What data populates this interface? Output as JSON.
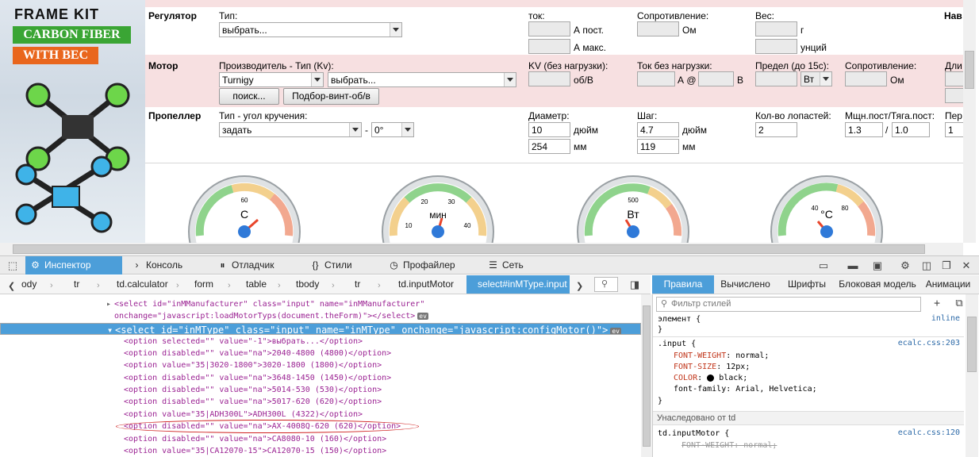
{
  "ad": {
    "line1": "FRAME KIT",
    "line2": "CARBON FIBER",
    "line3": "WITH BEC"
  },
  "form": {
    "regulator": {
      "title": "Регулятор",
      "type_label": "Тип:",
      "type_value": "выбрать...",
      "current_label": "ток:",
      "unit_a_const": "А пост.",
      "unit_a_max": "А макс.",
      "resistance_label": "Сопротивление:",
      "unit_ohm": "Ом",
      "weight_label": "Вес:",
      "unit_g": "г",
      "unit_oz": "унций",
      "nav_label": "Нав"
    },
    "motor": {
      "title": "Мотор",
      "manufacturer_label": "Производитель - Тип (Kv):",
      "manufacturer_value": "Turnigy",
      "type_value": "выбрать...",
      "kv_label": "KV (без нагрузки):",
      "unit_rpm_v": "об/В",
      "noload_label": "Ток без нагрузки:",
      "unit_a_at": "А @",
      "unit_v": "В",
      "limit_label": "Предел (до 15с):",
      "limit_unit_value": "Вт",
      "resistance_label": "Сопротивление:",
      "unit_ohm": "Ом",
      "extra_label": "Дли",
      "search_button": "поиск...",
      "match_button": "Подбор-винт-об/в"
    },
    "propeller": {
      "title": "Пропеллер",
      "type_label": "Тип - угол кручения:",
      "type_value": "задать",
      "dash": "-",
      "angle_value": "0°",
      "diameter_label": "Диаметр:",
      "diameter_in": "10",
      "unit_inch": "дюйм",
      "diameter_mm": "254",
      "unit_mm": "мм",
      "pitch_label": "Шаг:",
      "pitch_in": "4.7",
      "pitch_mm": "119",
      "blades_label": "Кол-во лопастей:",
      "blades_value": "2",
      "power_label": "Мщн.пост/Тяга.пост:",
      "power_value": "1.3",
      "slash": "/",
      "thrust_value": "1.0",
      "extra_label": "Пер",
      "extra_value": "1"
    },
    "gauges": [
      {
        "unit": "С",
        "ticks": [
          "60"
        ]
      },
      {
        "unit": "мин",
        "ticks": [
          "20",
          "30",
          "10",
          "40"
        ]
      },
      {
        "unit": "Вт",
        "ticks": [
          "500"
        ]
      },
      {
        "unit": "°С",
        "ticks": [
          "40",
          "80"
        ]
      }
    ]
  },
  "devtools": {
    "tabs": [
      {
        "label": "Инспектор",
        "icon": "inspector-icon"
      },
      {
        "label": "Консоль",
        "icon": "console-icon"
      },
      {
        "label": "Отладчик",
        "icon": "debugger-icon"
      },
      {
        "label": "Стили",
        "icon": "style-editor-icon"
      },
      {
        "label": "Профайлер",
        "icon": "profiler-icon"
      },
      {
        "label": "Сеть",
        "icon": "network-icon"
      }
    ],
    "breadcrumbs": [
      "ody",
      "tr",
      "td.calculator",
      "form",
      "table",
      "tbody",
      "tr",
      "td.inputMotor",
      "select#inMType.input"
    ],
    "side_tabs": [
      "Правила",
      "Вычислено",
      "Шрифты",
      "Блоковая модель",
      "Анимации"
    ],
    "code_lines": [
      {
        "text": "<select id=\"inMManufacturer\" class=\"input\" name=\"inMManufacturer\"",
        "indent": 1
      },
      {
        "text": "onchange=\"javascript:loadMotorTyps(document.theForm)\"></select>",
        "indent": 1
      },
      {
        "text": "<select id=\"inMType\" class=\"input\" name=\"inMType\" onchange=\"javascript:configMotor()\">",
        "indent": 1
      },
      {
        "text": "<option selected=\"\" value=\"-1\">выбрать...</option>",
        "indent": 2
      },
      {
        "text": "<option disabled=\"\" value=\"na\">2040-4800 (4800)</option>",
        "indent": 2
      },
      {
        "text": "<option value=\"35|3020-1800\">3020-1800 (1800)</option>",
        "indent": 2
      },
      {
        "text": "<option disabled=\"\" value=\"na\">3648-1450 (1450)</option>",
        "indent": 2
      },
      {
        "text": "<option disabled=\"\" value=\"na\">5014-530 (530)</option>",
        "indent": 2
      },
      {
        "text": "<option disabled=\"\" value=\"na\">5017-620 (620)</option>",
        "indent": 2
      },
      {
        "text": "<option value=\"35|ADH300L\">ADH300L (4322)</option>",
        "indent": 2
      },
      {
        "text": "<option disabled=\"\" value=\"na\">AX-4008Q-620 (620)</option>",
        "indent": 2
      },
      {
        "text": "<option disabled=\"\" value=\"na\">CA8080-10 (160)</option>",
        "indent": 2
      },
      {
        "text": "<option value=\"35|CA12070-15\">CA12070-15 (150)</option>",
        "indent": 2
      }
    ],
    "ev_badge": "ev",
    "filter_placeholder": "Фильтр стилей",
    "rules": {
      "element_rule": "элемент {",
      "element_src": "inline",
      "close": "}",
      "input_selector": ".input {",
      "input_src": "ecalc.css:203",
      "props": [
        {
          "name": "FONT-WEIGHT",
          "value": "normal;"
        },
        {
          "name": "FONT-SIZE",
          "value": "12px;"
        },
        {
          "name": "COLOR",
          "value": "black;"
        }
      ],
      "font_family_line": "font-family: Arial, Helvetica;",
      "inherited_label": "Унаследовано от td",
      "td_selector": "td.inputMotor {",
      "td_src": "ecalc.css:120",
      "td_prop": "FONT-WEIGHT: normal;"
    },
    "accent": "#4c9ed9"
  }
}
